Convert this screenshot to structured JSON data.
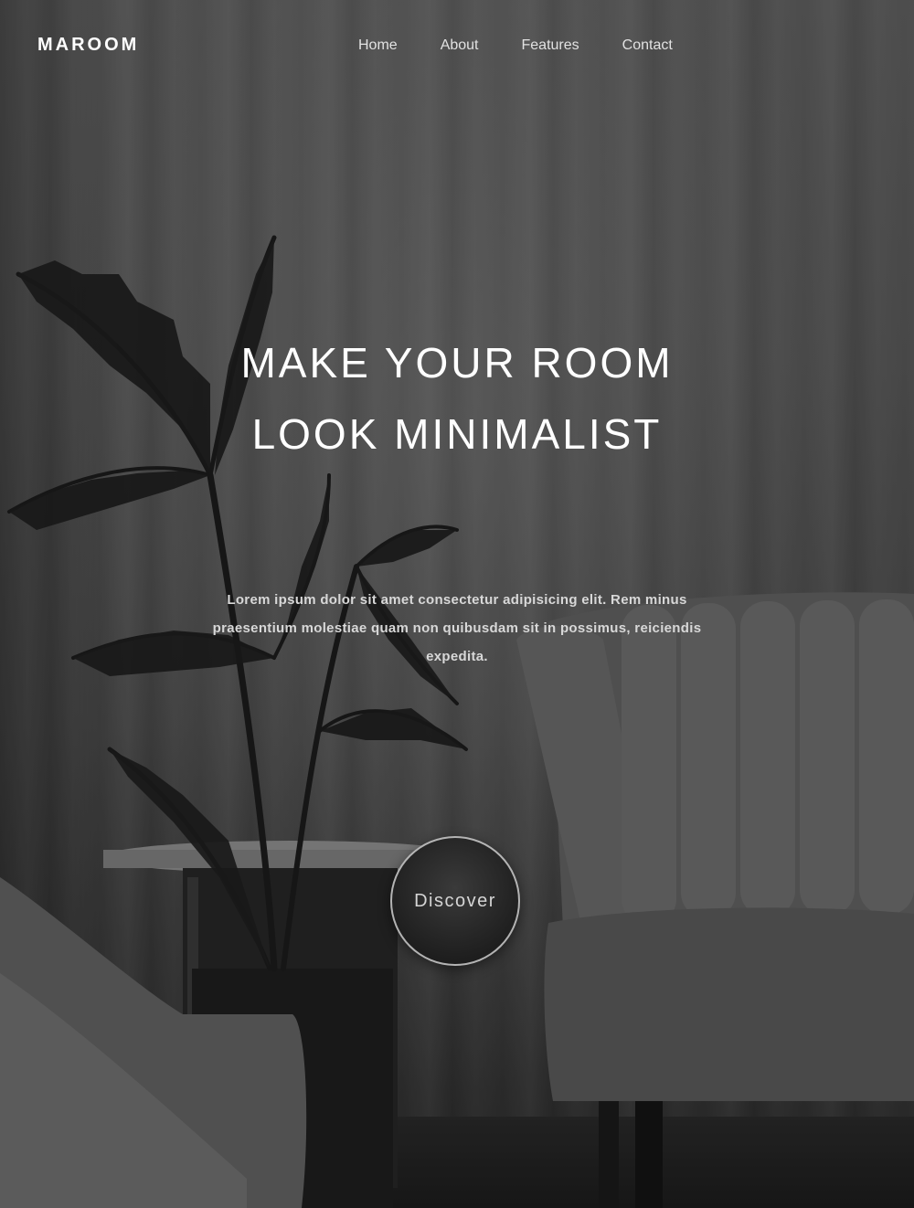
{
  "brand": {
    "logo": "MAROOM"
  },
  "nav": {
    "home": "Home",
    "about": "About",
    "features": "Features",
    "contact": "Contact"
  },
  "hero": {
    "headline_line1": "MAKE YOUR ROOM",
    "headline_line2": "LOOK MINIMALIST",
    "description": "Lorem ipsum dolor sit amet consectetur adipisicing elit. Rem minus praesentium molestiae quam non quibusdam sit in possimus, reiciendis expedita.",
    "cta_label": "Discover"
  },
  "colors": {
    "text": "#ffffff",
    "nav_text": "#e2e2e2",
    "background": "#555555",
    "button_bg": "#1f1f1f",
    "button_border": "#e6e6e6"
  }
}
